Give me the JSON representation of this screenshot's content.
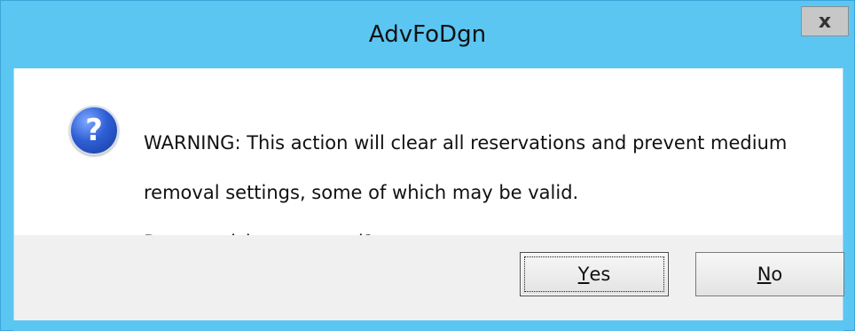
{
  "window": {
    "title": "AdvFoDgn",
    "close_glyph": "x",
    "accent_color": "#5cc6f2"
  },
  "message": {
    "icon": "question-icon",
    "icon_glyph": "?",
    "line1": "WARNING: This action will clear all reservations and prevent medium",
    "line2": "removal settings, some of which may be valid.",
    "line3": "Do you wish to proceed?"
  },
  "buttons": {
    "yes": {
      "mnemonic": "Y",
      "rest": "es",
      "focused": true
    },
    "no": {
      "mnemonic": "N",
      "rest": "o",
      "focused": false
    }
  }
}
